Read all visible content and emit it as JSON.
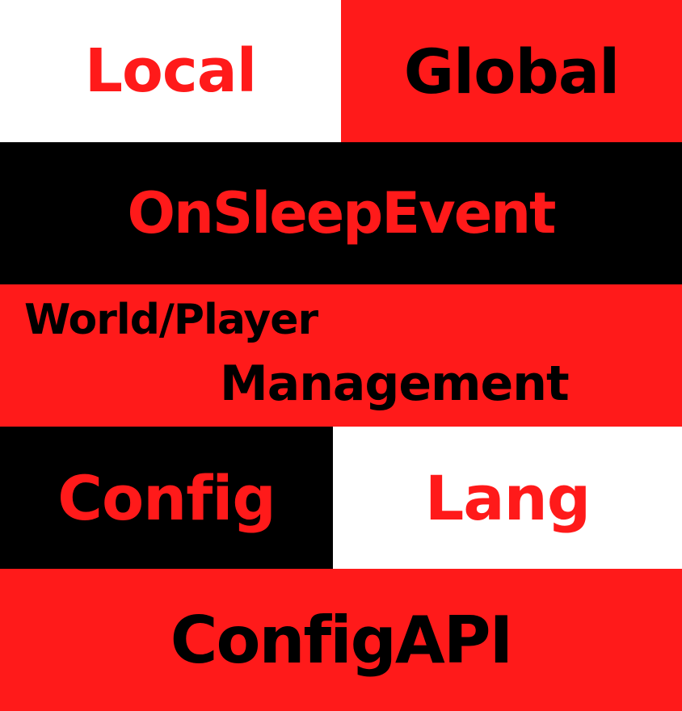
{
  "blocks": {
    "local": "Local",
    "global": "Global",
    "sleep_event": "OnSleepEvent",
    "world_player_line1": "World/Player",
    "world_player_line2": "Management",
    "config": "Config",
    "lang": "Lang",
    "config_api": "ConfigAPI"
  },
  "colors": {
    "red": "#ff1a1a",
    "black": "#000000",
    "white": "#ffffff"
  }
}
